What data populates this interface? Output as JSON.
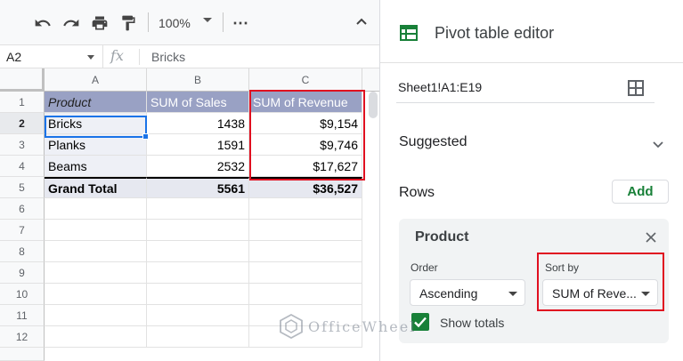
{
  "toolbar": {
    "zoom": "100%",
    "more_label": "⋯"
  },
  "formula_bar": {
    "cell_ref": "A2",
    "fx_label": "fx",
    "content": "Bricks"
  },
  "grid": {
    "columns": [
      "A",
      "B",
      "C"
    ],
    "row_numbers": [
      "1",
      "2",
      "3",
      "4",
      "5",
      "6",
      "7",
      "8",
      "9",
      "10",
      "11",
      "12"
    ],
    "header": [
      "Product",
      "SUM of Sales",
      "SUM of Revenue"
    ],
    "rows": [
      [
        "Bricks",
        "1438",
        "$9,154"
      ],
      [
        "Planks",
        "1591",
        "$9,746"
      ],
      [
        "Beams",
        "2532",
        "$17,627"
      ]
    ],
    "total": [
      "Grand Total",
      "5561",
      "$36,527"
    ]
  },
  "pivot_editor": {
    "title": "Pivot table editor",
    "range": "Sheet1!A1:E19",
    "suggested_label": "Suggested",
    "rows_label": "Rows",
    "add_label": "Add",
    "card": {
      "title": "Product",
      "order_label": "Order",
      "order_value": "Ascending",
      "sortby_label": "Sort by",
      "sortby_value": "SUM of Reve...",
      "show_totals_label": "Show totals",
      "show_totals_checked": true
    }
  },
  "watermark": {
    "text": "OfficeWheel"
  },
  "colors": {
    "header_fill": "#99a1c4",
    "selection": "#1a73e8",
    "highlight_box": "#e01020",
    "accent_green": "#188038"
  }
}
